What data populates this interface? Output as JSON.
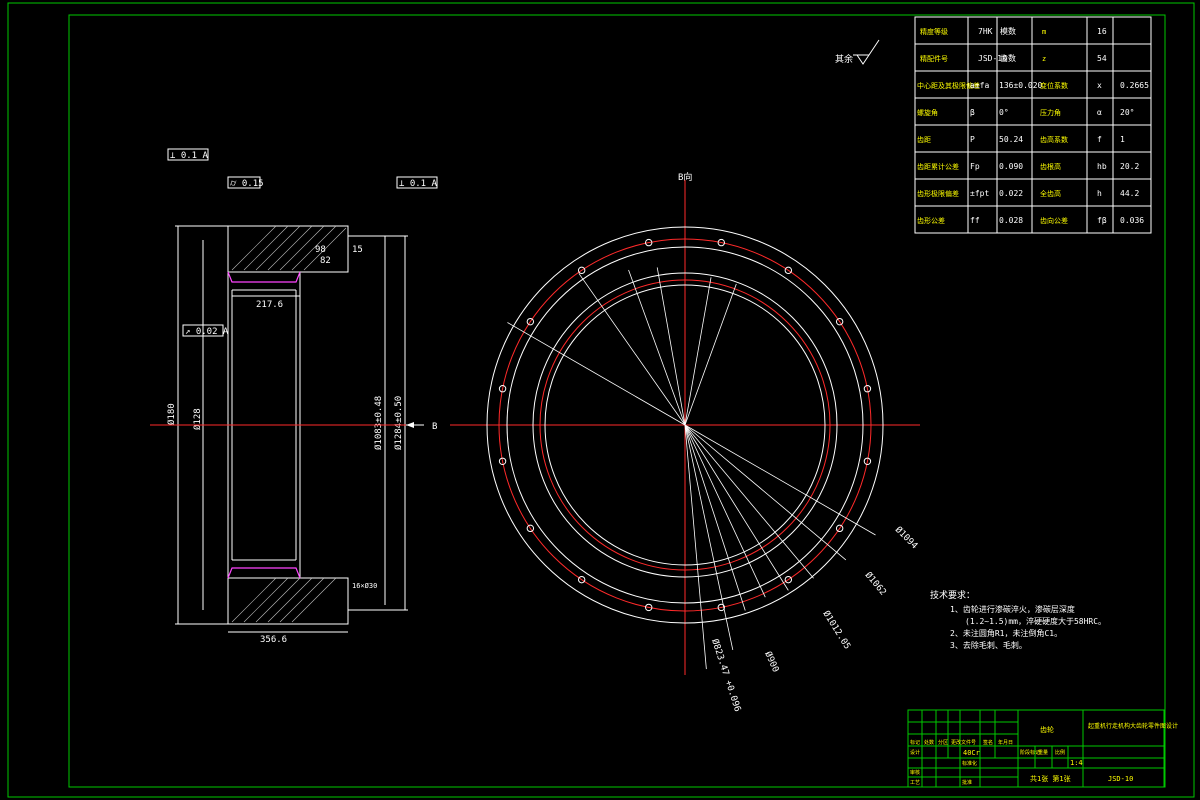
{
  "roughness_note": "其余",
  "datum_label": "B",
  "view_label": "B向",
  "section": {
    "flatness_tol": "⊥ 0.1 A",
    "cyl_tol": "⌭ 0.15",
    "perp_tol": "⊥ 0.1 A",
    "runout_tol": "↗ 0.02 A",
    "dims": {
      "d180": "Ø180",
      "d128": "Ø128",
      "d_root": "Ø1083±0.48",
      "d_outer": "Ø1284±0.50",
      "w356": "356.6",
      "w217": "217.6",
      "d98": "98",
      "d82": "82",
      "w15": "15",
      "bolt_note": "16×Ø30"
    }
  },
  "circle_labels": {
    "d1094": "Ø1094",
    "d1062": "Ø1062",
    "d1012": "Ø1012.05",
    "d900": "Ø900",
    "d823": "Ø823.47 +0.096"
  },
  "params_table": [
    [
      "精度等级",
      "7HK",
      "模数",
      "m",
      "16"
    ],
    [
      "精配件号",
      "JSD-10",
      "齿数",
      "z",
      "54"
    ],
    [
      "中心距及其极限偏差",
      "a±fa",
      "136±0.020",
      "变位系数",
      "x",
      "0.2665"
    ],
    [
      "螺旋角",
      "β",
      "0°",
      "压力角",
      "α",
      "20°"
    ],
    [
      "齿距",
      "P",
      "50.24",
      "齿高系数",
      "f",
      "1"
    ],
    [
      "齿距累计公差",
      "Fp",
      "0.090",
      "齿根高",
      "hb",
      "20.2"
    ],
    [
      "齿形极限偏差",
      "±fpt",
      "0.022",
      "全齿高",
      "h",
      "44.2"
    ],
    [
      "齿形公差",
      "ff",
      "0.028",
      "齿向公差",
      "fβ",
      "0.036"
    ]
  ],
  "tech_req": {
    "title": "技术要求：",
    "items": [
      "1、齿轮进行渗碳淬火，渗碳层深度",
      "(1.2~1.5)mm，淬硬硬度大于58HRC。",
      "2、未注圆角R1，未注倒角C1。",
      "3、去除毛刺、毛刺。"
    ]
  },
  "title_block": {
    "part_name": "齿轮",
    "title_main": "起重机行走机构大齿轮零件图设计",
    "material": "40Cr",
    "scale": "1:4",
    "sheet": "共1张 第1张",
    "drawing_no": "JSD-10",
    "labels": [
      "标记",
      "处数",
      "分区",
      "更改文件号",
      "签名",
      "年月日",
      "设计",
      "审核",
      "工艺",
      "批准",
      "标准化",
      "阶段标记",
      "重量",
      "比例"
    ]
  }
}
